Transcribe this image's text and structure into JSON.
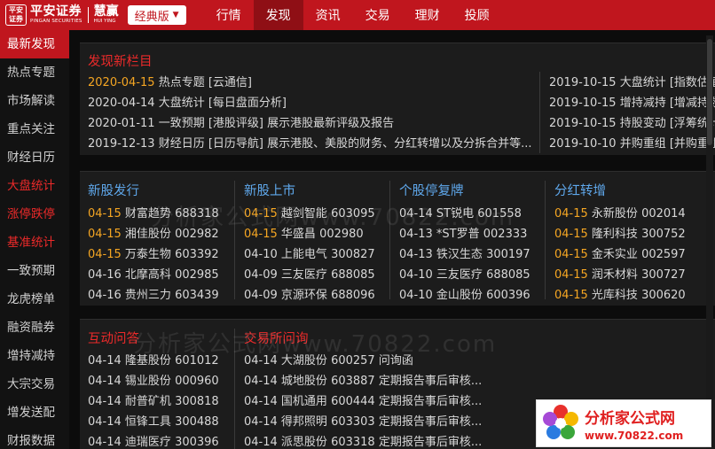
{
  "brand": {
    "logo_mark": "平安\n证券",
    "name": "平安证券",
    "name_en": "PINGAN SECURITIES",
    "product": "慧赢",
    "product_en": "HUI YING"
  },
  "edition": {
    "label": "经典版"
  },
  "nav": [
    {
      "label": "行情"
    },
    {
      "label": "发现",
      "active": true
    },
    {
      "label": "资讯"
    },
    {
      "label": "交易"
    },
    {
      "label": "理财"
    },
    {
      "label": "投顾"
    }
  ],
  "sidebar": [
    {
      "label": "最新发现"
    },
    {
      "label": "热点专题"
    },
    {
      "label": "市场解读"
    },
    {
      "label": "重点关注"
    },
    {
      "label": "财经日历"
    },
    {
      "label": "大盘统计"
    },
    {
      "label": "涨停跌停"
    },
    {
      "label": "基准统计"
    },
    {
      "label": "一致预期"
    },
    {
      "label": "龙虎榜单"
    },
    {
      "label": "融资融券"
    },
    {
      "label": "增持减持"
    },
    {
      "label": "大宗交易"
    },
    {
      "label": "增发送配"
    },
    {
      "label": "财报数据"
    }
  ],
  "new_columns": {
    "title": "发现新栏目",
    "left": [
      {
        "date": "2020-04-15",
        "text": " 热点专题 [云通信]"
      },
      {
        "date": "2020-04-14",
        "text": " 大盘统计 [每日盘面分析]"
      },
      {
        "date": "2020-01-11",
        "text": " 一致预期 [港股评级]  展示港股最新评级及报告"
      },
      {
        "date": "2019-12-13",
        "text": " 财经日历 [日历导航]  展示港股、美股的财务、分红转增以及分拆合并等..."
      }
    ],
    "right": [
      {
        "date": "2019-10-15",
        "text": " 大盘统计 [指数估值"
      },
      {
        "date": "2019-10-15",
        "text": " 增持减持 [增减持数"
      },
      {
        "date": "2019-10-15",
        "text": " 持股变动 [浮筹统计"
      },
      {
        "date": "2019-10-10",
        "text": " 并购重组 [并购重组"
      }
    ]
  },
  "ipo": {
    "title": "新股发行",
    "rows": [
      {
        "date": "04-15",
        "name": "财富趋势",
        "code": "688318"
      },
      {
        "date": "04-15",
        "name": "湘佳股份",
        "code": "002982"
      },
      {
        "date": "04-15",
        "name": "万泰生物",
        "code": "603392"
      },
      {
        "date": "04-16",
        "name": "北摩高科",
        "code": "002985"
      },
      {
        "date": "04-16",
        "name": "贵州三力",
        "code": "603439"
      }
    ]
  },
  "listing": {
    "title": "新股上市",
    "rows": [
      {
        "date": "04-15",
        "name": "越剑智能",
        "code": "603095"
      },
      {
        "date": "04-15",
        "name": "华盛昌",
        "code": "002980"
      },
      {
        "date": "04-10",
        "name": "上能电气",
        "code": "300827"
      },
      {
        "date": "04-09",
        "name": "三友医疗",
        "code": "688085"
      },
      {
        "date": "04-09",
        "name": "京源环保",
        "code": "688096"
      }
    ]
  },
  "resume": {
    "title": "个股停复牌",
    "rows": [
      {
        "date": "04-14",
        "name": "ST锐电",
        "code": "601558"
      },
      {
        "date": "04-13",
        "name": "*ST罗普",
        "code": "002333"
      },
      {
        "date": "04-13",
        "name": "铁汉生态",
        "code": "300197"
      },
      {
        "date": "04-10",
        "name": "三友医疗",
        "code": "688085"
      },
      {
        "date": "04-10",
        "name": "金山股份",
        "code": "600396"
      }
    ]
  },
  "dividend": {
    "title": "分红转增",
    "rows": [
      {
        "date": "04-15",
        "name": "永新股份",
        "code": "002014"
      },
      {
        "date": "04-15",
        "name": "隆利科技",
        "code": "300752"
      },
      {
        "date": "04-15",
        "name": "金禾实业",
        "code": "002597"
      },
      {
        "date": "04-15",
        "name": "润禾材料",
        "code": "300727"
      },
      {
        "date": "04-15",
        "name": "光库科技",
        "code": "300620"
      }
    ]
  },
  "qa": {
    "title": "互动问答",
    "rows": [
      {
        "date": "04-14",
        "name": "隆基股份",
        "code": "601012"
      },
      {
        "date": "04-14",
        "name": "锡业股份",
        "code": "000960"
      },
      {
        "date": "04-14",
        "name": "耐普矿机",
        "code": "300818"
      },
      {
        "date": "04-14",
        "name": "恒锋工具",
        "code": "300488"
      },
      {
        "date": "04-14",
        "name": "迪瑞医疗",
        "code": "300396"
      }
    ]
  },
  "inquiry": {
    "title": "交易所问询",
    "rows": [
      {
        "date": "04-14",
        "name": "大湖股份",
        "code": "600257",
        "desc": "问询函"
      },
      {
        "date": "04-14",
        "name": "城地股份",
        "code": "603887",
        "desc": "定期报告事后审核..."
      },
      {
        "date": "04-14",
        "name": "国机通用",
        "code": "600444",
        "desc": "定期报告事后审核..."
      },
      {
        "date": "04-14",
        "name": "得邦照明",
        "code": "603303",
        "desc": "定期报告事后审核..."
      },
      {
        "date": "04-14",
        "name": "派思股份",
        "code": "603318",
        "desc": "定期报告事后审核..."
      }
    ]
  },
  "watermark": {
    "text1": "分析家公式网www.70822.com",
    "text2": "分析家公式网www.70822.com"
  },
  "badge": {
    "title": "分析家公式网",
    "url": "www.70822.com"
  },
  "colors": {
    "brand_red": "#c0161e",
    "highlight_orange": "#f5a623",
    "title_blue": "#5fa8ec",
    "title_red": "#ec2a2a"
  }
}
